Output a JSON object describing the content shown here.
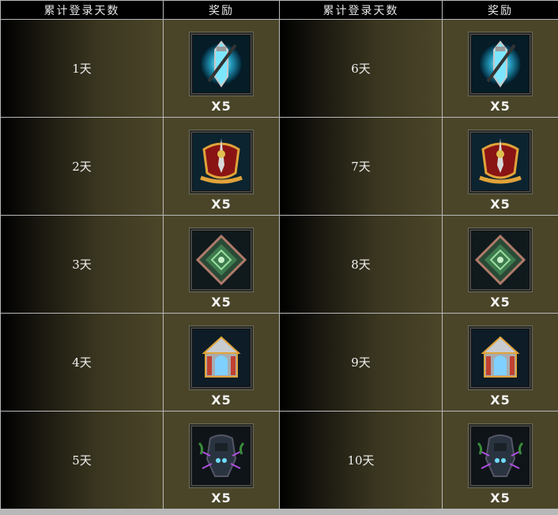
{
  "headers": [
    "累计登录天数",
    "奖励",
    "累计登录天数",
    "奖励"
  ],
  "rows": [
    {
      "left": {
        "day": "1天",
        "icon": "blue-lantern-icon",
        "qty": "X5"
      },
      "right": {
        "day": "6天",
        "icon": "blue-lantern-icon",
        "qty": "X5"
      }
    },
    {
      "left": {
        "day": "2天",
        "icon": "red-gold-crest-icon",
        "qty": "X5"
      },
      "right": {
        "day": "7天",
        "icon": "red-gold-crest-icon",
        "qty": "X5"
      }
    },
    {
      "left": {
        "day": "3天",
        "icon": "green-rune-icon",
        "qty": "X5"
      },
      "right": {
        "day": "8天",
        "icon": "green-rune-icon",
        "qty": "X5"
      }
    },
    {
      "left": {
        "day": "4天",
        "icon": "silver-shrine-icon",
        "qty": "X5"
      },
      "right": {
        "day": "9天",
        "icon": "silver-shrine-icon",
        "qty": "X5"
      }
    },
    {
      "left": {
        "day": "5天",
        "icon": "dark-armor-icon",
        "qty": "X5"
      },
      "right": {
        "day": "10天",
        "icon": "dark-armor-icon",
        "qty": "X5"
      }
    }
  ]
}
